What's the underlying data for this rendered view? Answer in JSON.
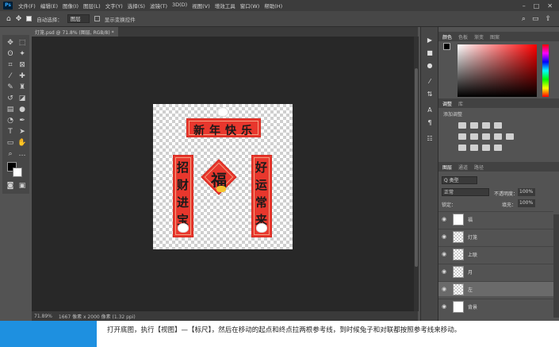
{
  "menubar": {
    "app_logo": "Ps",
    "items": [
      "文件(F)",
      "编辑(E)",
      "图像(I)",
      "图层(L)",
      "文字(Y)",
      "选择(S)",
      "滤镜(T)",
      "3D(D)",
      "视图(V)",
      "增效工具",
      "窗口(W)",
      "帮助(H)"
    ]
  },
  "options": {
    "auto_select_label": "自动选择：",
    "auto_select_value": "图层",
    "transform_label": "显示变换控件"
  },
  "document": {
    "tab_label": "灯笼.psd @ 71.8% (图层, RGB/8) *",
    "zoom": "71.89%",
    "doc_info": "1667 像素 x 2000 像素 (1.32 ppi)"
  },
  "artwork": {
    "top_banner": [
      "新",
      "年",
      "快",
      "乐"
    ],
    "left_couplet": [
      "招",
      "财",
      "进",
      "宝"
    ],
    "right_couplet": [
      "好",
      "运",
      "常",
      "来"
    ],
    "center_char": "福"
  },
  "color_panel": {
    "tabs": [
      "颜色",
      "色板",
      "渐变",
      "图案"
    ],
    "fg": "#000000",
    "bg": "#ffffff"
  },
  "adjust_panel": {
    "tabs": [
      "调整",
      "库"
    ],
    "title": "添加调整"
  },
  "layers_panel": {
    "tabs": [
      "图层",
      "通道",
      "路径"
    ],
    "filter_label": "Q 类型",
    "blend_mode": "正常",
    "opacity_label": "不透明度：",
    "opacity_value": "100%",
    "lock_label": "锁定：",
    "fill_label": "填充：",
    "fill_value": "100%",
    "layers": [
      {
        "name": "福",
        "selected": false
      },
      {
        "name": "灯笼",
        "selected": false
      },
      {
        "name": "上联",
        "selected": false
      },
      {
        "name": "月",
        "selected": false
      },
      {
        "name": "左",
        "selected": true
      },
      {
        "name": "背景",
        "selected": false
      }
    ]
  },
  "caption": {
    "text": "打开底图，执行【视图】—【标尺】，然后在移动的起点和终点拉两根参考线，到时候兔子和对联都按照参考线来移动。"
  }
}
